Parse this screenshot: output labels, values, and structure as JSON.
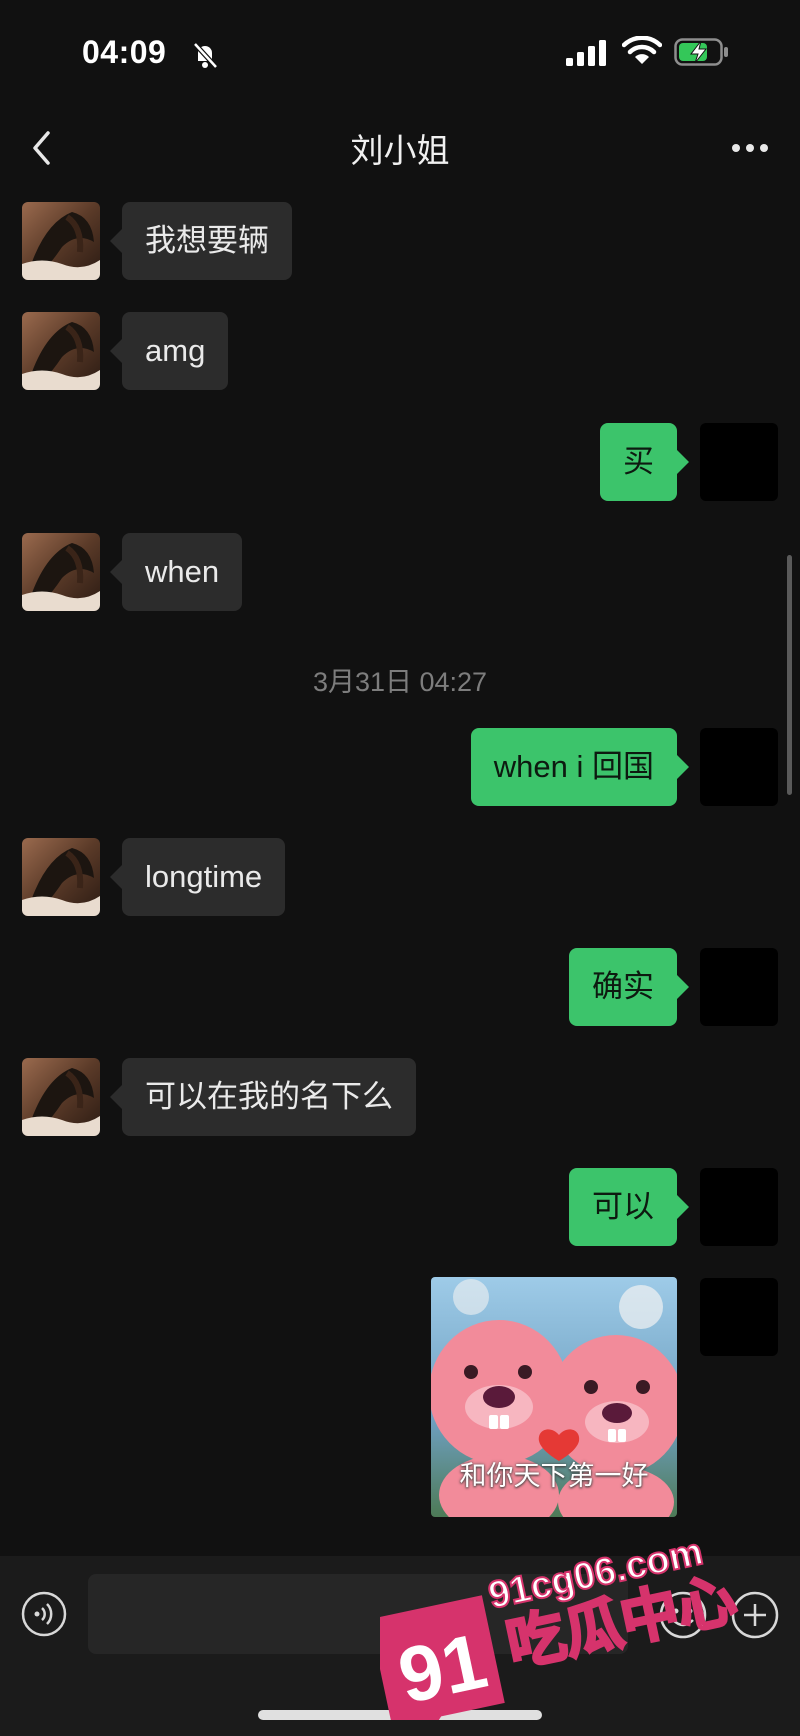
{
  "status_bar": {
    "time": "04:09",
    "bell_icon": "bell-slash-icon",
    "signal_icon": "cellular-signal-icon",
    "wifi_icon": "wifi-icon",
    "battery_icon": "battery-charging-icon",
    "battery_color": "#34c759"
  },
  "header": {
    "title": "刘小姐",
    "back_icon": "chevron-left-icon",
    "more_icon": "ellipsis-icon"
  },
  "messages": [
    {
      "side": "in",
      "text": "我想要辆"
    },
    {
      "side": "in",
      "text": "amg"
    },
    {
      "side": "out",
      "text": "买"
    },
    {
      "side": "in",
      "text": "when"
    },
    {
      "side": "out",
      "text": "when i 回国"
    },
    {
      "side": "in",
      "text": "longtime"
    },
    {
      "side": "out",
      "text": "确实"
    },
    {
      "side": "in",
      "text": "可以在我的名下么"
    },
    {
      "side": "out",
      "text": "可以"
    }
  ],
  "timestamp": "3月31日 04:27",
  "sticker": {
    "caption": "和你天下第一好",
    "icon": "pink-beaver-heart-sticker"
  },
  "input_bar": {
    "voice_icon": "voice-wave-icon",
    "emoji_icon": "smiley-icon",
    "plus_icon": "plus-circle-icon"
  },
  "watermark": {
    "number": "91",
    "domain": "91cg06.com",
    "name": "吃瓜中心",
    "color": "#d6336c"
  },
  "colors": {
    "background": "#111111",
    "incoming_bubble": "#2c2c2c",
    "outgoing_bubble": "#3cc46b"
  }
}
